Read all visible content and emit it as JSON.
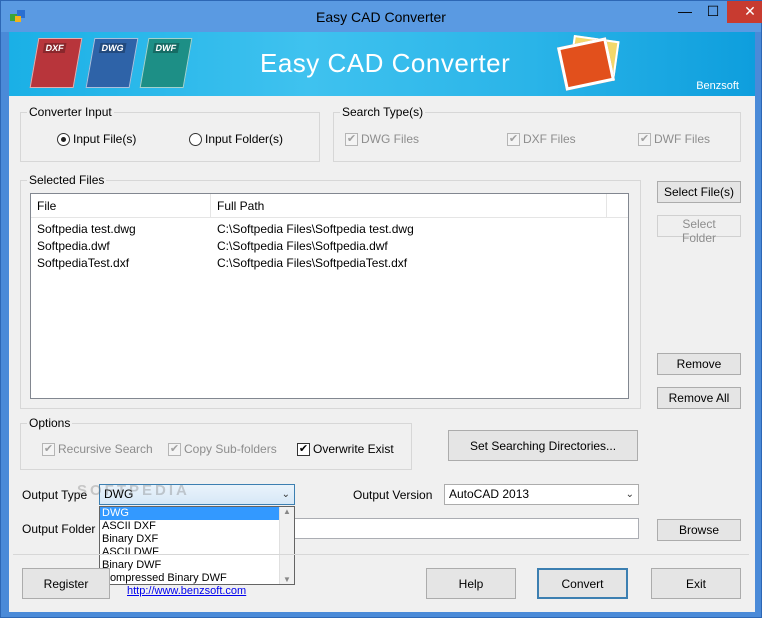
{
  "window": {
    "title": "Easy CAD Converter",
    "controls": {
      "minimize": "—",
      "maximize": "☐",
      "close": "✕"
    }
  },
  "banner": {
    "title": "Easy CAD Converter",
    "company": "Benzsoft",
    "file_icons": [
      "DXF",
      "DWG",
      "DWF"
    ],
    "colors": {
      "dxf": "#b8353b",
      "dwg": "#2e63a8",
      "dwf": "#1d8f86"
    }
  },
  "converter_input": {
    "legend": "Converter Input",
    "options": [
      {
        "label": "Input File(s)",
        "selected": true
      },
      {
        "label": "Input Folder(s)",
        "selected": false
      }
    ]
  },
  "search_types": {
    "legend": "Search Type(s)",
    "options": [
      {
        "label": "DWG Files",
        "checked": true
      },
      {
        "label": "DXF Files",
        "checked": true
      },
      {
        "label": "DWF Files",
        "checked": true
      }
    ]
  },
  "selected_files": {
    "legend": "Selected Files",
    "columns": [
      "File",
      "Full Path"
    ],
    "rows": [
      [
        "Softpedia test.dwg",
        "C:\\Softpedia Files\\Softpedia test.dwg"
      ],
      [
        "Softpedia.dwf",
        "C:\\Softpedia Files\\Softpedia.dwf"
      ],
      [
        "SoftpediaTest.dxf",
        "C:\\Softpedia Files\\SoftpediaTest.dxf"
      ]
    ]
  },
  "side_buttons": {
    "select_files": "Select File(s)",
    "select_folder": "Select Folder",
    "remove": "Remove",
    "remove_all": "Remove All"
  },
  "options": {
    "legend": "Options",
    "items": [
      {
        "label": "Recursive Search",
        "checked": true
      },
      {
        "label": "Copy Sub-folders",
        "checked": true
      },
      {
        "label": "Overwrite Exist",
        "checked": true
      }
    ],
    "set_dirs_button": "Set Searching Directories..."
  },
  "output": {
    "type_label": "Output Type",
    "type_value": "DWG",
    "type_options": [
      "DWG",
      "ASCII DXF",
      "Binary DXF",
      "ASCII DWF",
      "Binary DWF",
      "Compressed Binary DWF"
    ],
    "version_label": "Output Version",
    "version_value": "AutoCAD 2013",
    "folder_label": "Output Folder",
    "folder_value": "",
    "browse_button": "Browse"
  },
  "bottom": {
    "register": "Register",
    "link": "http://www.benzsoft.com",
    "help": "Help",
    "convert": "Convert",
    "exit": "Exit"
  },
  "watermark": "SOFTPEDIA",
  "check_mark": "✔"
}
